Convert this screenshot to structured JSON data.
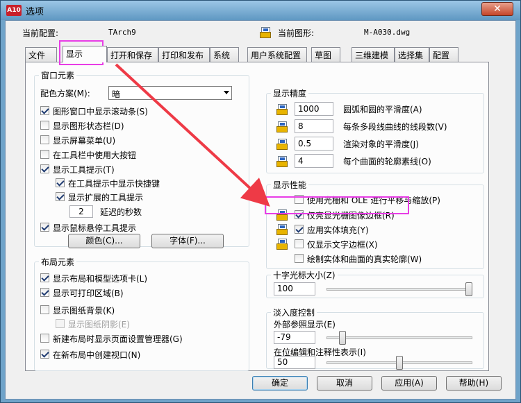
{
  "window": {
    "title": "选项",
    "app_icon_text": "A10",
    "close_glyph": "✕"
  },
  "profile": {
    "current_profile_label": "当前配置:",
    "current_profile_value": "TArch9",
    "current_drawing_label": "当前图形:",
    "current_drawing_value": "M-A030.dwg"
  },
  "tabs": [
    {
      "label": "文件",
      "active": false
    },
    {
      "label": "显示",
      "active": true
    },
    {
      "label": "打开和保存",
      "active": false
    },
    {
      "label": "打印和发布",
      "active": false
    },
    {
      "label": "系统",
      "active": false
    },
    {
      "label": "用户系统配置",
      "active": false
    },
    {
      "label": "草图",
      "active": false
    },
    {
      "label": "三维建模",
      "active": false
    },
    {
      "label": "选择集",
      "active": false
    },
    {
      "label": "配置",
      "active": false
    }
  ],
  "window_elements": {
    "title": "窗口元素",
    "color_scheme_label": "配色方案(M):",
    "color_scheme_value": "暗",
    "items": [
      {
        "label": "图形窗口中显示滚动条(S)",
        "checked": true,
        "disabled": false
      },
      {
        "label": "显示图形状态栏(D)",
        "checked": false,
        "disabled": false
      },
      {
        "label": "显示屏幕菜单(U)",
        "checked": false,
        "disabled": false
      },
      {
        "label": "在工具栏中使用大按钮",
        "checked": false,
        "disabled": false
      },
      {
        "label": "显示工具提示(T)",
        "checked": true,
        "disabled": false
      },
      {
        "label": "在工具提示中显示快捷键",
        "checked": true,
        "disabled": false
      },
      {
        "label": "显示扩展的工具提示",
        "checked": true,
        "disabled": false
      },
      {
        "label": "显示鼠标悬停工具提示",
        "checked": true,
        "disabled": false
      }
    ],
    "delay_value": "2",
    "delay_label": "延迟的秒数",
    "colors_button": "颜色(C)...",
    "fonts_button": "字体(F)..."
  },
  "layout_elements": {
    "title": "布局元素",
    "items": [
      {
        "label": "显示布局和模型选项卡(L)",
        "checked": true,
        "disabled": false
      },
      {
        "label": "显示可打印区域(B)",
        "checked": true,
        "disabled": false
      },
      {
        "label": "显示图纸背景(K)",
        "checked": false,
        "disabled": false
      },
      {
        "label": "显示图纸阴影(E)",
        "checked": false,
        "disabled": true
      },
      {
        "label": "新建布局时显示页面设置管理器(G)",
        "checked": false,
        "disabled": false
      },
      {
        "label": "在新布局中创建视口(N)",
        "checked": true,
        "disabled": false
      }
    ]
  },
  "display_resolution": {
    "title": "显示精度",
    "items": [
      {
        "value": "1000",
        "label": "圆弧和圆的平滑度(A)"
      },
      {
        "value": "8",
        "label": "每条多段线曲线的线段数(V)"
      },
      {
        "value": "0.5",
        "label": "渲染对象的平滑度(J)"
      },
      {
        "value": "4",
        "label": "每个曲面的轮廓素线(O)"
      }
    ]
  },
  "display_performance": {
    "title": "显示性能",
    "items": [
      {
        "label": "使用光栅和 OLE 进行平移与缩放(P)",
        "checked": false
      },
      {
        "label": "仅亮显光栅图像边框(R)",
        "checked": true
      },
      {
        "label": "应用实体填充(Y)",
        "checked": true
      },
      {
        "label": "仅显示文字边框(X)",
        "checked": false
      },
      {
        "label": "绘制实体和曲面的真实轮廓(W)",
        "checked": false
      }
    ]
  },
  "crosshair": {
    "title": "十字光标大小(Z)",
    "value": "100",
    "level_percent": 100
  },
  "fade_control": {
    "title": "淡入度控制",
    "xref_label": "外部参照显示(E)",
    "xref_value": "-79",
    "xref_level_percent": 9,
    "inplace_label": "在位编辑和注释性表示(I)",
    "inplace_value": "50",
    "inplace_level_percent": 50
  },
  "buttons": {
    "ok": "确定",
    "cancel": "取消",
    "apply": "应用(A)",
    "help": "帮助(H)"
  },
  "colors": {
    "highlight": "#e83de6",
    "arrow": "#ee3a46"
  }
}
